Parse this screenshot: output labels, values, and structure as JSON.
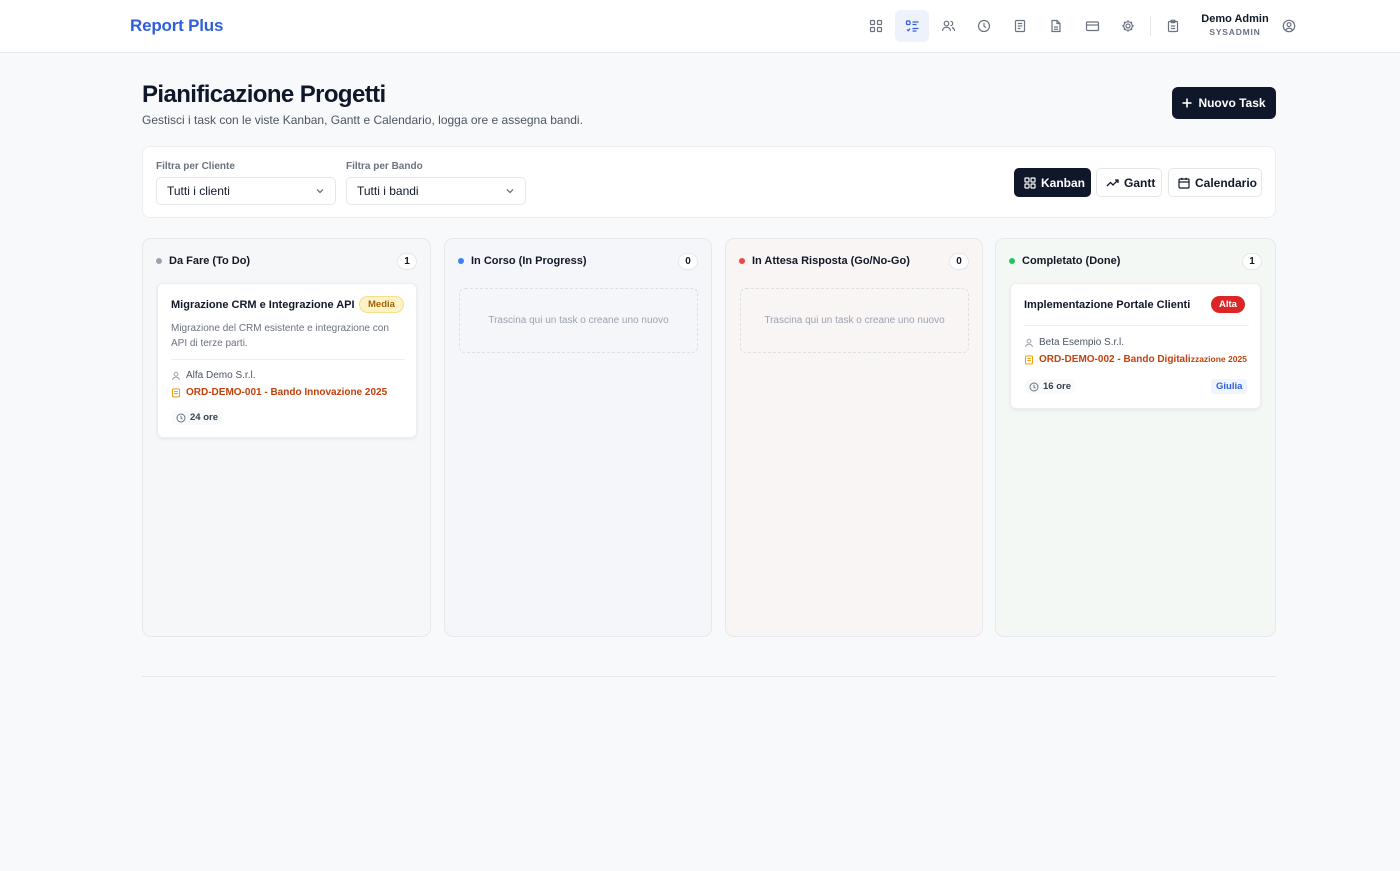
{
  "app": {
    "brand": "Report Plus"
  },
  "nav": {
    "icons": [
      "dashboard-icon",
      "tasks-icon",
      "users-icon",
      "clock-icon",
      "reports-icon",
      "document-icon",
      "card-icon",
      "settings-icon",
      "clipboard-icon"
    ],
    "active": "tasks-icon"
  },
  "user": {
    "name": "Demo Admin",
    "role": "SYSADMIN"
  },
  "header": {
    "title": "Pianificazione Progetti",
    "subtitle": "Gestisci i task con le viste Kanban, Gantt e Calendario, logga ore e assegna bandi.",
    "new_task_label": "Nuovo Task"
  },
  "filters": {
    "client_label": "Filtra per Cliente",
    "client_value": "Tutti i clienti",
    "bando_label": "Filtra per Bando",
    "bando_value": "Tutti i bandi"
  },
  "views": {
    "kanban": "Kanban",
    "gantt": "Gantt",
    "calendar": "Calendario",
    "active": "Kanban"
  },
  "columns": [
    {
      "title": "Da Fare (To Do)",
      "count": "1",
      "dot_color": "#9ca3af",
      "cards": [
        {
          "title": "Migrazione CRM e Integrazione API",
          "priority": "Media",
          "description": "Migrazione del CRM esistente e integrazione con API di terze parti.",
          "client": "Alfa Demo S.r.l.",
          "order": "ORD-DEMO-001 - Bando Innovazione 2025",
          "hours": "24 ore"
        }
      ]
    },
    {
      "title": "In Corso (In Progress)",
      "count": "0",
      "dot_color": "#3b82f6",
      "empty_text": "Trascina qui un task o creane uno nuovo",
      "cards": []
    },
    {
      "title": "In Attesa Risposta (Go/No-Go)",
      "count": "0",
      "dot_color": "#ef4444",
      "empty_text": "Trascina qui un task o creane uno nuovo",
      "cards": []
    },
    {
      "title": "Completato (Done)",
      "count": "1",
      "dot_color": "#22c55e",
      "cards": [
        {
          "title": "Implementazione Portale Clienti",
          "priority": "Alta",
          "client": "Beta Esempio S.r.l.",
          "order_main": "ORD-DEMO-002 - Bando Digitali",
          "order_tail": "zzazione 2025",
          "hours": "16 ore",
          "assignee": "Giulia"
        }
      ]
    }
  ],
  "colors": {
    "brand": "#2f5fd9",
    "primary_dark": "#0f172a",
    "order_link": "#c2410c",
    "priority_media_bg": "#fdf3c7",
    "priority_media_text": "#a16207",
    "priority_alta_bg": "#dc2626",
    "priority_alta_text": "#ffffff"
  }
}
